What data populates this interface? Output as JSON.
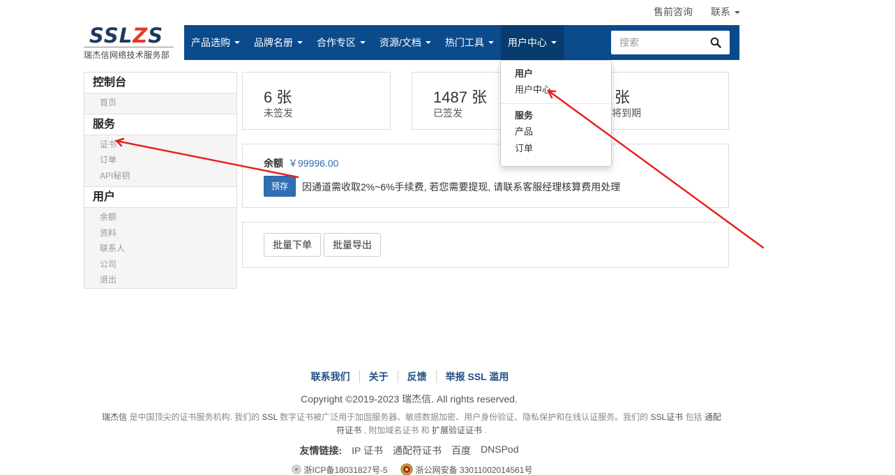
{
  "top_links": {
    "presale": "售前咨询",
    "contact": "联系"
  },
  "logo": {
    "mark_a": "SSL",
    "mark_z": "Z",
    "mark_b": "S",
    "subtitle": "瑞杰信网络技术服务部"
  },
  "nav": {
    "items": [
      "产品选购",
      "品牌名册",
      "合作专区",
      "资源/文档",
      "热门工具",
      "用户中心"
    ],
    "search_placeholder": "搜索"
  },
  "dropdown": {
    "header_user": "用户",
    "user_center": "用户中心",
    "header_service": "服务",
    "product": "产品",
    "order": "订单"
  },
  "sidebar": {
    "console": "控制台",
    "home": "首页",
    "service": "服务",
    "certificate": "证书",
    "order": "订单",
    "api_key": "API秘钥",
    "user": "用户",
    "balance": "余额",
    "profile": "资料",
    "contacts": "联系人",
    "company": "公司",
    "logout": "退出"
  },
  "stats": [
    {
      "value": "6 张",
      "label": "未签发"
    },
    {
      "value": "1487 张",
      "label": "已签发"
    },
    {
      "value": "张",
      "label": "将到期"
    }
  ],
  "balance": {
    "label": "余额",
    "value": "￥99996.00",
    "deposit_button": "预存",
    "note": "因通道需收取2%~6%手续费, 若您需要提现, 请联系客服经理核算费用处理"
  },
  "actions": {
    "batch_order": "批量下单",
    "batch_export": "批量导出"
  },
  "footer": {
    "links": [
      "联系我们",
      "关于",
      "反馈",
      "举报 SSL 滥用"
    ],
    "copyright": "Copyright ©2019-2023 瑞杰信. All rights reserved.",
    "about": {
      "brand": "瑞杰信",
      "t1": " 是中国顶尖的证书服务机构. 我们的 ",
      "ssl": "SSL",
      "t2": " 数字证书被广泛用于加固服务器、敏感数据加密、用户身份验证、隐私保护和在线认证服务。我们的 ",
      "ssl_cert": "SSL证书",
      "t3": " 包括 ",
      "wildcard": "通配符证书",
      "t4": " , 附加域名证书 ",
      "t5": "和 ",
      "ev": "扩展验证证书",
      "t6": " ."
    },
    "friends_title": "友情链接:",
    "friends": [
      "IP 证书",
      "通配符证书",
      "百度",
      "DNSPod"
    ],
    "icp": "浙ICP备18031827号-5",
    "police": "浙公网安备 33011002014561号"
  },
  "colors": {
    "nav_bg": "#0b4a8b",
    "nav_active": "#083b70",
    "arrow": "#e8201a",
    "accent": "#2f6fb3"
  }
}
